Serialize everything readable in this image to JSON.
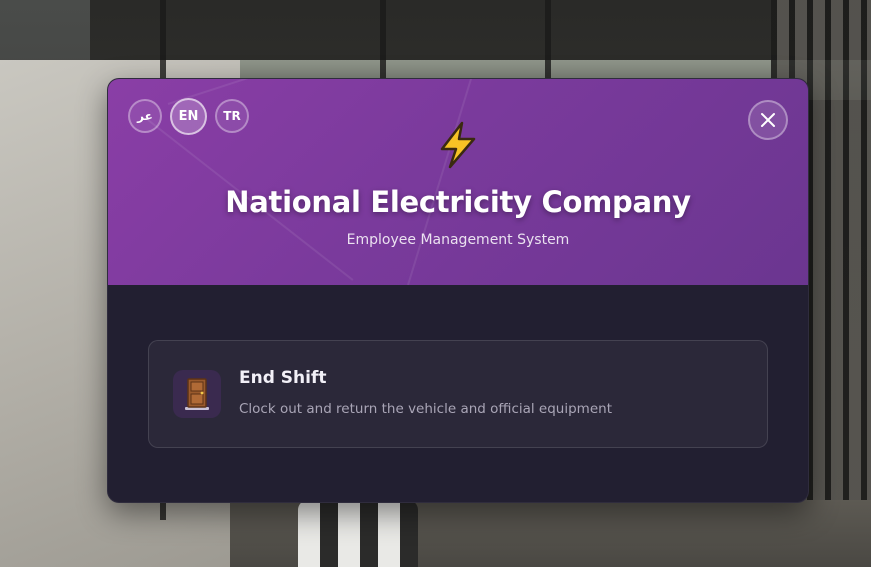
{
  "language_switcher": {
    "options": [
      {
        "label": "عر",
        "active": false
      },
      {
        "label": "EN",
        "active": true
      },
      {
        "label": "TR",
        "active": false
      }
    ]
  },
  "header": {
    "icon": "lightning-bolt-icon",
    "title": "National Electricity Company",
    "subtitle": "Employee Management System",
    "accent_color": "#7e3ba0"
  },
  "close_button": {
    "icon": "close-icon"
  },
  "actions": [
    {
      "icon": "door-icon",
      "title": "End Shift",
      "description": "Clock out and return the vehicle and official equipment"
    }
  ],
  "colors": {
    "panel_bg": "#221f31",
    "card_bg": "#2b2839",
    "bolt_yellow": "#f7c325"
  }
}
